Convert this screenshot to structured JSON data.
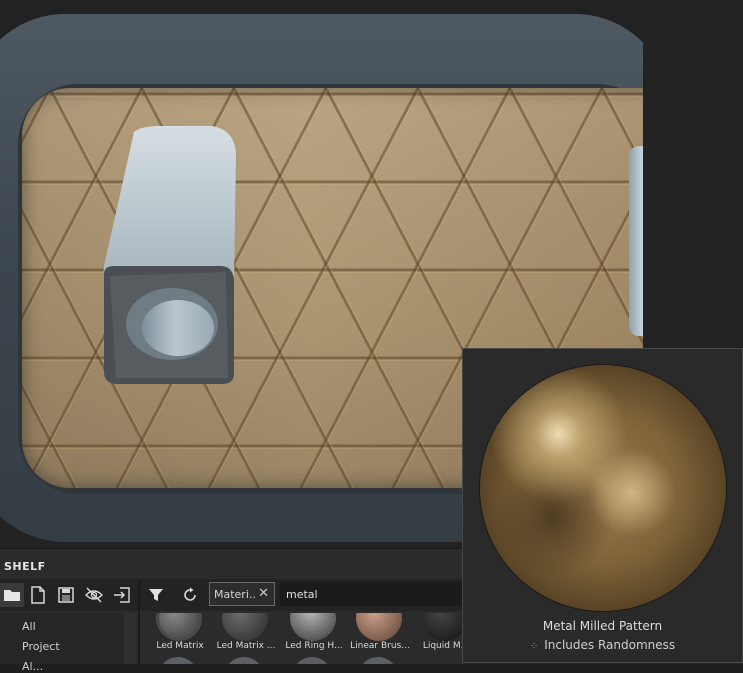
{
  "shelf": {
    "title": "SHELF",
    "toolbar_icons": [
      "folder-icon",
      "new-item-icon",
      "save-icon",
      "visibility-off-icon",
      "import-icon"
    ],
    "filter_chip": {
      "label": "Materi..",
      "close_glyph": "✕"
    },
    "search": {
      "value": "metal"
    },
    "categories": [
      "All",
      "Project",
      "Al..."
    ],
    "thumbnails": [
      {
        "label": "Led Matrix"
      },
      {
        "label": "Led Matrix ..."
      },
      {
        "label": "Led Ring H..."
      },
      {
        "label": "Linear Brus..."
      },
      {
        "label": "Liquid M..."
      }
    ]
  },
  "preview": {
    "name": "Metal Milled Pattern",
    "tag": "Includes Randomness"
  },
  "colors": {
    "background": "#1f1f1f",
    "shelf_bg": "#2b2b2b",
    "panel_gold": "#b59d77",
    "frame_gray": "#4f5962"
  }
}
